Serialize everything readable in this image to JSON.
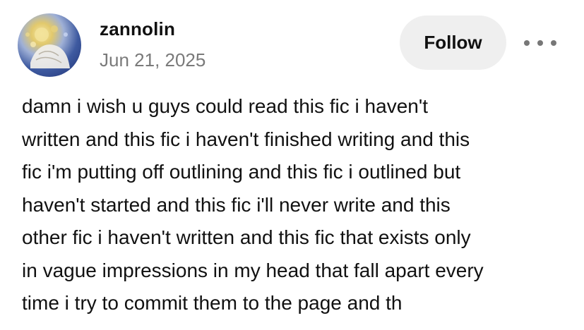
{
  "author": {
    "username": "zannolin",
    "date": "Jun 21, 2025",
    "avatar_icon": "artwork-avatar-icon"
  },
  "actions": {
    "follow_label": "Follow",
    "more_icon": "more-options-icon"
  },
  "post": {
    "lines": [
      "damn i wish u guys could read this fic i haven't",
      "written and this fic i haven't finished writing and this",
      "fic i'm putting off outlining and this fic i outlined but",
      "haven't started and this fic i'll never write and this",
      "other fic i haven't written and this fic that exists only",
      "in vague impressions in my head that fall apart every",
      "time i try to commit them to the page and th"
    ]
  },
  "colors": {
    "follow_bg": "#efefef",
    "date_text": "#7a7a7a",
    "body_text": "#111111"
  }
}
